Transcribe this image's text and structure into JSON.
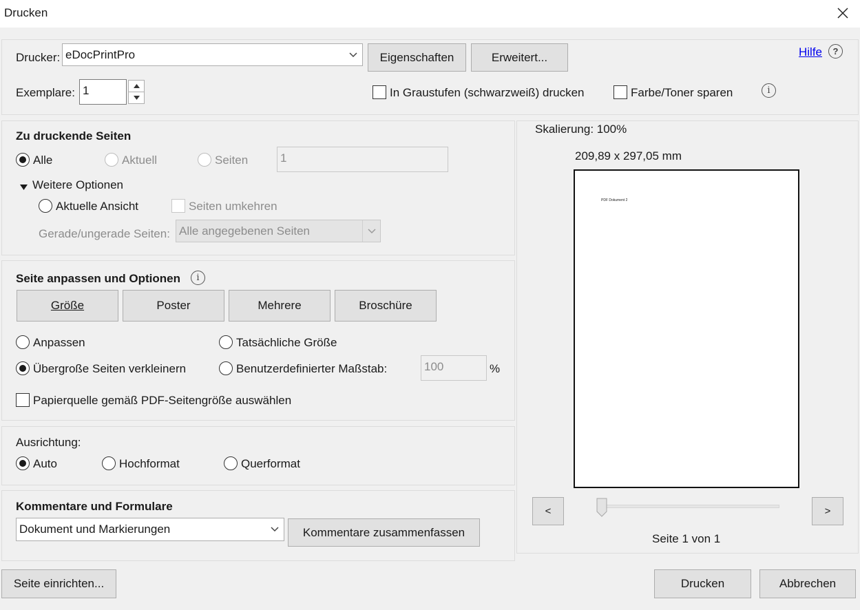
{
  "window": {
    "title": "Drucken"
  },
  "printer": {
    "label": "Drucker:",
    "value": "eDocPrintPro",
    "properties_button": "Eigenschaften",
    "advanced_button": "Erweitert...",
    "help_link": "Hilfe",
    "copies_label": "Exemplare:",
    "copies_value": "1",
    "grayscale_label": "In Graustufen (schwarzweiß) drucken",
    "save_toner_label": "Farbe/Toner sparen"
  },
  "pages": {
    "heading": "Zu druckende Seiten",
    "all_label": "Alle",
    "current_label": "Aktuell",
    "pages_label": "Seiten",
    "pages_value": "1",
    "more_options_label": "Weitere Optionen",
    "current_view_label": "Aktuelle Ansicht",
    "reverse_label": "Seiten umkehren",
    "odd_even_label": "Gerade/ungerade Seiten:",
    "odd_even_value": "Alle angegebenen Seiten"
  },
  "sizing": {
    "heading": "Seite anpassen und Optionen",
    "tabs": [
      "Größe",
      "Poster",
      "Mehrere",
      "Broschüre"
    ],
    "fit_label": "Anpassen",
    "actual_size_label": "Tatsächliche Größe",
    "shrink_label": "Übergroße Seiten verkleinern",
    "custom_scale_label": "Benutzerdefinierter Maßstab:",
    "custom_scale_value": "100",
    "percent": "%",
    "paper_source_label": "Papierquelle gemäß PDF-Seitengröße auswählen"
  },
  "orientation": {
    "heading": "Ausrichtung:",
    "auto_label": "Auto",
    "portrait_label": "Hochformat",
    "landscape_label": "Querformat"
  },
  "comments": {
    "heading": "Kommentare und Formulare",
    "select_value": "Dokument und Markierungen",
    "summarize_button": "Kommentare zusammenfassen"
  },
  "preview": {
    "scaling": "Skalierung: 100%",
    "dimensions": "209,89 x 297,05 mm",
    "page_text": "PDF Dokument 2",
    "prev": "<",
    "next": ">",
    "page_counter": "Seite 1 von 1",
    "slider_position": 0
  },
  "footer": {
    "page_setup_button": "Seite einrichten...",
    "print_button": "Drucken",
    "cancel_button": "Abbrechen"
  }
}
